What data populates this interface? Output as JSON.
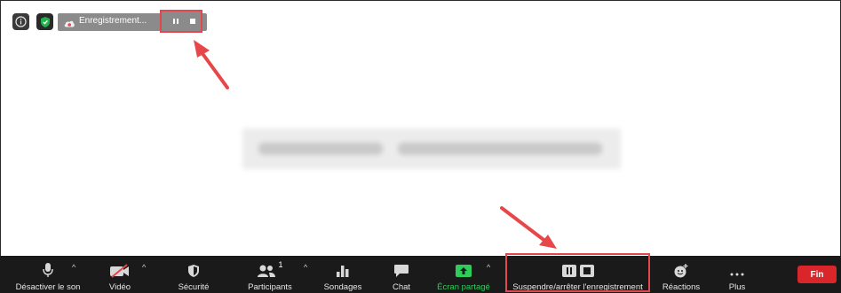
{
  "recording": {
    "status_label": "Enregistrement...",
    "icons": [
      "info-icon",
      "shield-icon",
      "cloud-recording-icon",
      "pause-icon",
      "stop-icon"
    ]
  },
  "toolbar": {
    "items": [
      {
        "label": "Désactiver le son",
        "icon": "microphone-icon"
      },
      {
        "label": "Vidéo",
        "icon": "video-off-icon"
      },
      {
        "label": "Sécurité",
        "icon": "shield-icon"
      },
      {
        "label": "Participants",
        "icon": "participants-icon",
        "count": "1"
      },
      {
        "label": "Sondages",
        "icon": "polls-icon"
      },
      {
        "label": "Chat",
        "icon": "chat-icon"
      },
      {
        "label": "Écran partagé",
        "icon": "share-screen-icon"
      },
      {
        "label": "Suspendre/arrêter l'enregistrement",
        "icon": "pause-stop-recording-icon"
      },
      {
        "label": "Réactions",
        "icon": "reactions-icon"
      },
      {
        "label": "Plus",
        "icon": "more-icon"
      }
    ],
    "end_label": "Fin",
    "caret_glyph": "^"
  },
  "colors": {
    "toolbar_bg": "#1a1a1a",
    "highlight": "#e0474e",
    "share_green": "#2ecc5a",
    "end_red": "#d8262b",
    "shield_green": "#22b14c"
  }
}
